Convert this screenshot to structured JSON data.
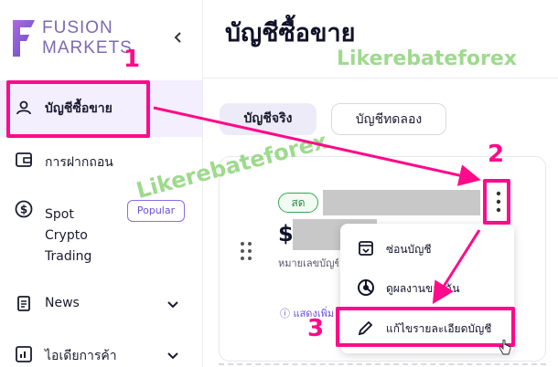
{
  "sidebar": {
    "logo": {
      "line1": "FUSION",
      "line2": "MARKETS"
    },
    "items": [
      {
        "label": "บัญชีซื้อขาย",
        "icon": "user-icon"
      },
      {
        "label": "การฝากถอน",
        "icon": "wallet-icon"
      },
      {
        "label_lines": [
          "Spot",
          "Crypto",
          "Trading"
        ],
        "icon": "dollar-circle-icon",
        "badge": "Popular"
      },
      {
        "label": "News",
        "icon": "clipboard-icon"
      },
      {
        "label": "ไอเดียการค้า",
        "icon": "chart-icon"
      }
    ]
  },
  "main": {
    "title": "บัญชีซื้อขาย",
    "tabs": [
      {
        "label": "บัญชีจริง"
      },
      {
        "label": "บัญชีทดลอง"
      }
    ],
    "card": {
      "status": "สด",
      "balance_prefix": "$",
      "account_label": "หมายเลขบัญชี",
      "more_link": "แสดงเพิ่ม"
    },
    "menu": [
      {
        "label": "ซ่อนบัญชี",
        "icon": "archive-icon"
      },
      {
        "label": "ดูผลงานของฉัน",
        "icon": "performance-icon"
      },
      {
        "label": "แก้ไขรายละเอียดบัญชี",
        "icon": "pencil-icon"
      }
    ]
  },
  "annotations": {
    "watermark": "Likerebateforex",
    "steps": [
      "1",
      "2",
      "3"
    ],
    "accent": "#ff0a8a"
  },
  "colors": {
    "brand": "#6b4fd6",
    "active_bg": "#f3efff",
    "live": "#34a853"
  }
}
